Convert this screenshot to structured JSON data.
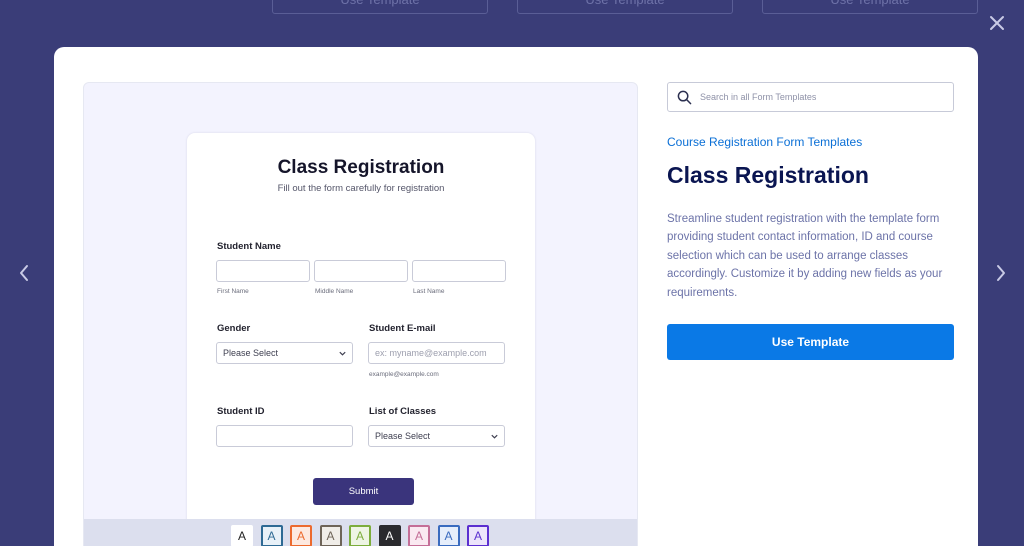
{
  "background": {
    "top_buttons": [
      "Use Template",
      "Use Template",
      "Use Template"
    ]
  },
  "colors": {
    "overlay": "#3a3d78",
    "accent": "#0a79e6",
    "title": "#0a1551",
    "description": "#6c73a8",
    "link": "#0a6fd6",
    "submit": "#3a347c"
  },
  "icons": {
    "close": "close-icon",
    "prev": "chevron-left-icon",
    "next": "chevron-right-icon",
    "search": "search-icon",
    "select": "chevron-down-icon"
  },
  "preview": {
    "form_title": "Class Registration",
    "form_subtitle": "Fill out the form carefully for registration",
    "student_name_label": "Student Name",
    "first_name_sublabel": "First Name",
    "middle_name_sublabel": "Middle Name",
    "last_name_sublabel": "Last Name",
    "gender_label": "Gender",
    "gender_value": "Please Select",
    "email_label": "Student E-mail",
    "email_placeholder": "ex: myname@example.com",
    "email_sublabel": "example@example.com",
    "student_id_label": "Student ID",
    "classes_label": "List of Classes",
    "classes_value": "Please Select",
    "submit_label": "Submit",
    "theme_swatches": [
      {
        "letter": "A",
        "bg": "#ffffff",
        "border": "#ffffff",
        "color": "#222222"
      },
      {
        "letter": "A",
        "bg": "#e8f1f8",
        "border": "#2e6a94",
        "color": "#2e6a94"
      },
      {
        "letter": "A",
        "bg": "#fde9e0",
        "border": "#ec6a2e",
        "color": "#ec6a2e"
      },
      {
        "letter": "A",
        "bg": "#f0ede8",
        "border": "#6e6458",
        "color": "#6e6458"
      },
      {
        "letter": "A",
        "bg": "#eef5e4",
        "border": "#7cad3c",
        "color": "#7cad3c"
      },
      {
        "letter": "A",
        "bg": "#2a2a2e",
        "border": "#2a2a2e",
        "color": "#ffffff"
      },
      {
        "letter": "A",
        "bg": "#fae9f1",
        "border": "#c46e97",
        "color": "#c46e97"
      },
      {
        "letter": "A",
        "bg": "#e6eefb",
        "border": "#3a6bbf",
        "color": "#3a6bbf"
      },
      {
        "letter": "A",
        "bg": "#ece4fb",
        "border": "#5b2fd0",
        "color": "#5b2fd0"
      }
    ]
  },
  "detail": {
    "search_placeholder": "Search in all Form Templates",
    "category": "Course Registration Form Templates",
    "title": "Class Registration",
    "description": "Streamline student registration with the template form providing student contact information, ID and course selection which can be used to arrange classes accordingly. Customize it by adding new fields as your requirements.",
    "use_template_label": "Use Template"
  }
}
